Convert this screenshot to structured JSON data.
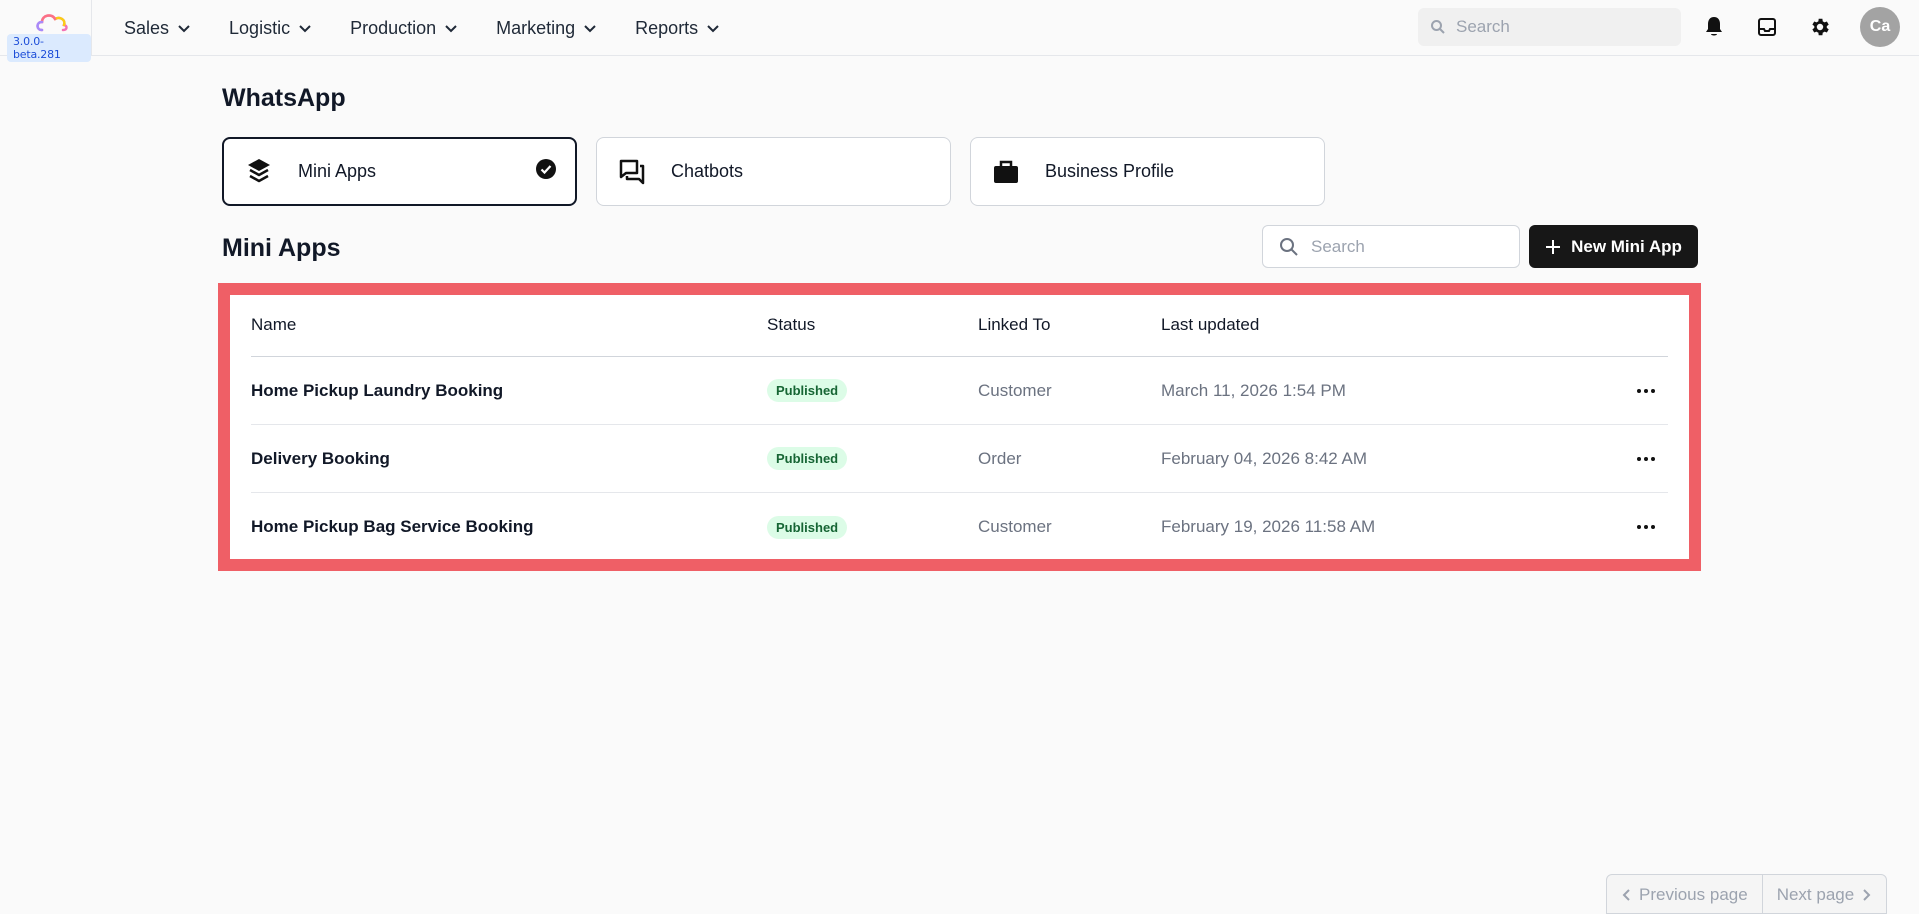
{
  "app": {
    "version": "3.0.0-beta.281"
  },
  "nav": {
    "menu": [
      {
        "label": "Sales"
      },
      {
        "label": "Logistic"
      },
      {
        "label": "Production"
      },
      {
        "label": "Marketing"
      },
      {
        "label": "Reports"
      }
    ],
    "search_placeholder": "Search",
    "avatar_initials": "Ca",
    "icons": [
      "bell-icon",
      "inbox-icon",
      "gear-icon"
    ]
  },
  "page": {
    "title": "WhatsApp",
    "cards": [
      {
        "label": "Mini Apps",
        "icon": "layers-icon",
        "active": true
      },
      {
        "label": "Chatbots",
        "icon": "chat-bubbles-icon",
        "active": false
      },
      {
        "label": "Business Profile",
        "icon": "briefcase-icon",
        "active": false
      }
    ]
  },
  "mini_apps": {
    "title": "Mini Apps",
    "search_placeholder": "Search",
    "new_button_label": "New Mini App",
    "columns": {
      "name": "Name",
      "status": "Status",
      "linked_to": "Linked To",
      "last_updated": "Last updated"
    },
    "rows": [
      {
        "name": "Home Pickup Laundry Booking",
        "status": "Published",
        "linked_to": "Customer",
        "last_updated": "March 11, 2026 1:54 PM"
      },
      {
        "name": "Delivery Booking",
        "status": "Published",
        "linked_to": "Order",
        "last_updated": "February 04, 2026 8:42 AM"
      },
      {
        "name": "Home Pickup Bag Service Booking",
        "status": "Published",
        "linked_to": "Customer",
        "last_updated": "February 19, 2026 11:58 AM"
      }
    ]
  },
  "pagination": {
    "previous_label": "Previous page",
    "next_label": "Next page"
  },
  "colors": {
    "highlight_border": "#ef5f66",
    "primary_button": "#171717",
    "published_badge_bg": "#dcfce7",
    "published_badge_text": "#166534"
  }
}
